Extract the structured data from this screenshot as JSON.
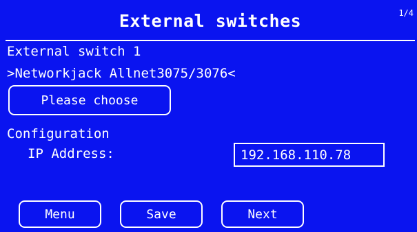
{
  "header": {
    "title": "External switches",
    "page_indicator": "1/4"
  },
  "switch": {
    "label": "External switch 1",
    "selected": ">Networkjack Allnet3075/3076<",
    "choose_button": "Please choose"
  },
  "config": {
    "section_label": "Configuration",
    "ip_label": "IP Address:",
    "ip_value": "192.168.110.78"
  },
  "footer": {
    "menu": "Menu",
    "save": "Save",
    "next": "Next"
  },
  "colors": {
    "background": "#0a14f0",
    "foreground": "#ffffff"
  }
}
